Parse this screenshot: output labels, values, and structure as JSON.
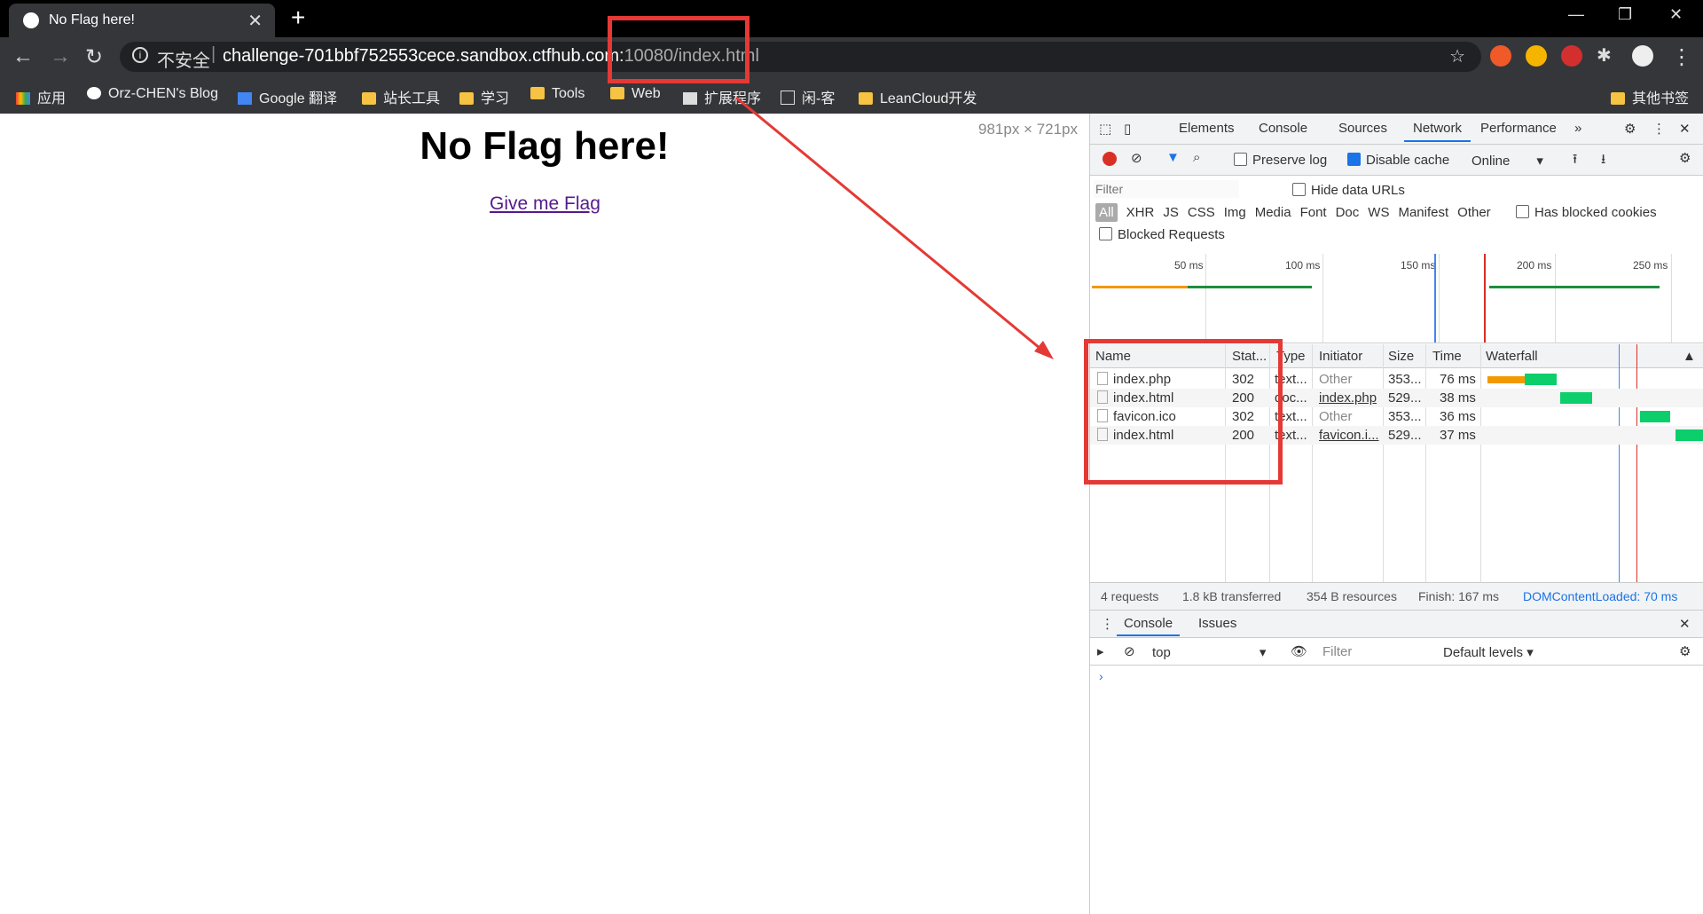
{
  "browser": {
    "tab_title": "No Flag here!",
    "tab_close": "✕",
    "new_tab": "+",
    "window_controls": [
      "—",
      "❐",
      "✕"
    ],
    "url_security": "不安全",
    "url_host": "challenge-701bbf752553cece.sandbox.ctfhub.com:",
    "url_port_path": "10080/index.html",
    "bookmarks": [
      "应用",
      "Orz-CHEN's Blog",
      "Google 翻译",
      "站长工具",
      "学习",
      "Tools",
      "Web",
      "扩展程序",
      "闲-客",
      "LeanCloud开发",
      "其他书签"
    ]
  },
  "page": {
    "heading": "No Flag here!",
    "link": "Give me Flag",
    "dims": "981px × 721px"
  },
  "devtools": {
    "tabs": [
      "Elements",
      "Console",
      "Sources",
      "Network",
      "Performance"
    ],
    "active_tab": "Network",
    "preserve_log": "Preserve log",
    "disable_cache": "Disable cache",
    "throttle": "Online",
    "filter_placeholder": "Filter",
    "hide_data_urls": "Hide data URLs",
    "types": [
      "All",
      "XHR",
      "JS",
      "CSS",
      "Img",
      "Media",
      "Font",
      "Doc",
      "WS",
      "Manifest",
      "Other"
    ],
    "has_blocked_cookies": "Has blocked cookies",
    "blocked_requests": "Blocked Requests",
    "timeline_ticks": [
      "50 ms",
      "100 ms",
      "150 ms",
      "200 ms",
      "250 ms"
    ],
    "columns": [
      "Name",
      "Stat...",
      "Type",
      "Initiator",
      "Size",
      "Time",
      "Waterfall"
    ],
    "rows": [
      {
        "name": "index.php",
        "status": "302",
        "type": "text...",
        "initiator": "Other",
        "size": "353...",
        "time": "76 ms"
      },
      {
        "name": "index.html",
        "status": "200",
        "type": "doc...",
        "initiator": "index.php",
        "size": "529...",
        "time": "38 ms"
      },
      {
        "name": "favicon.ico",
        "status": "302",
        "type": "text...",
        "initiator": "Other",
        "size": "353...",
        "time": "36 ms"
      },
      {
        "name": "index.html",
        "status": "200",
        "type": "text...",
        "initiator": "favicon.i...",
        "size": "529...",
        "time": "37 ms"
      }
    ],
    "summary": {
      "requests": "4 requests",
      "transferred": "1.8 kB transferred",
      "resources": "354 B resources",
      "finish": "Finish: 167 ms",
      "dcl": "DOMContentLoaded: 70 ms"
    },
    "drawer_tabs": [
      "Console",
      "Issues"
    ],
    "context": "top",
    "console_filter": "Filter",
    "levels": "Default levels ▾",
    "prompt": "›"
  },
  "colors": {
    "accent": "#1a73e8",
    "annotation": "#e53935"
  }
}
